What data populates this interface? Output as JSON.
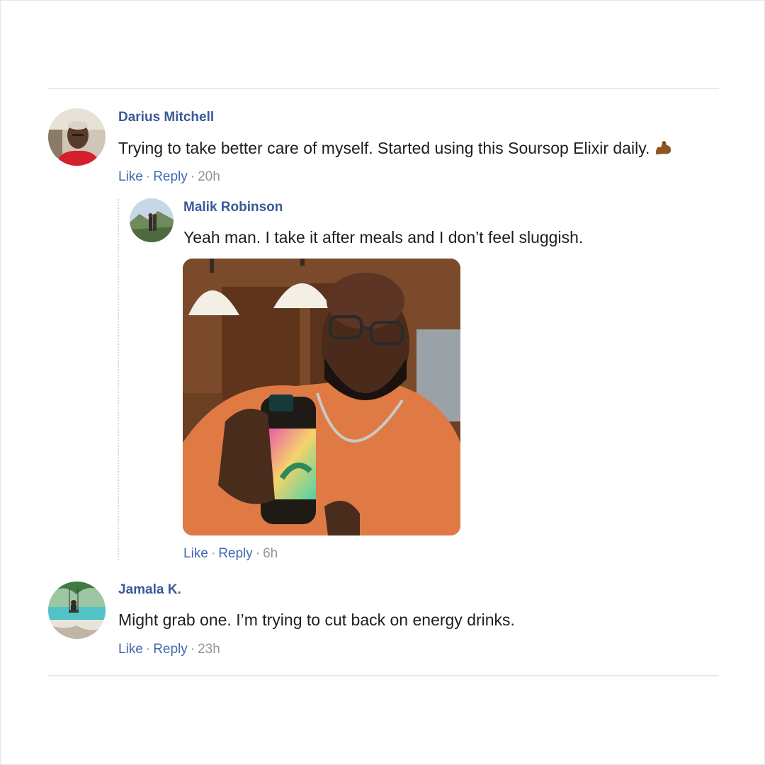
{
  "comments": [
    {
      "author": "Darius Mitchell",
      "text": "Trying to take better care of myself. Started using this Soursop Elixir daily.",
      "emoji": "flexed-biceps",
      "like_label": "Like",
      "reply_label": "Reply",
      "time": "20h"
    },
    {
      "author": "Malik Robinson",
      "text": "Yeah man. I take it after meals and I don’t feel sluggish.",
      "like_label": "Like",
      "reply_label": "Reply",
      "time": "6h"
    },
    {
      "author": "Jamala K.",
      "text": "Might grab one. I’m trying to cut back on energy drinks.",
      "like_label": "Like",
      "reply_label": "Reply",
      "time": "23h"
    }
  ],
  "separator": "·",
  "colors": {
    "author_name": "#3b5998",
    "link": "#4267b2",
    "meta": "#90949c",
    "body_text": "#1c1e21",
    "divider": "#e7e8ec"
  }
}
